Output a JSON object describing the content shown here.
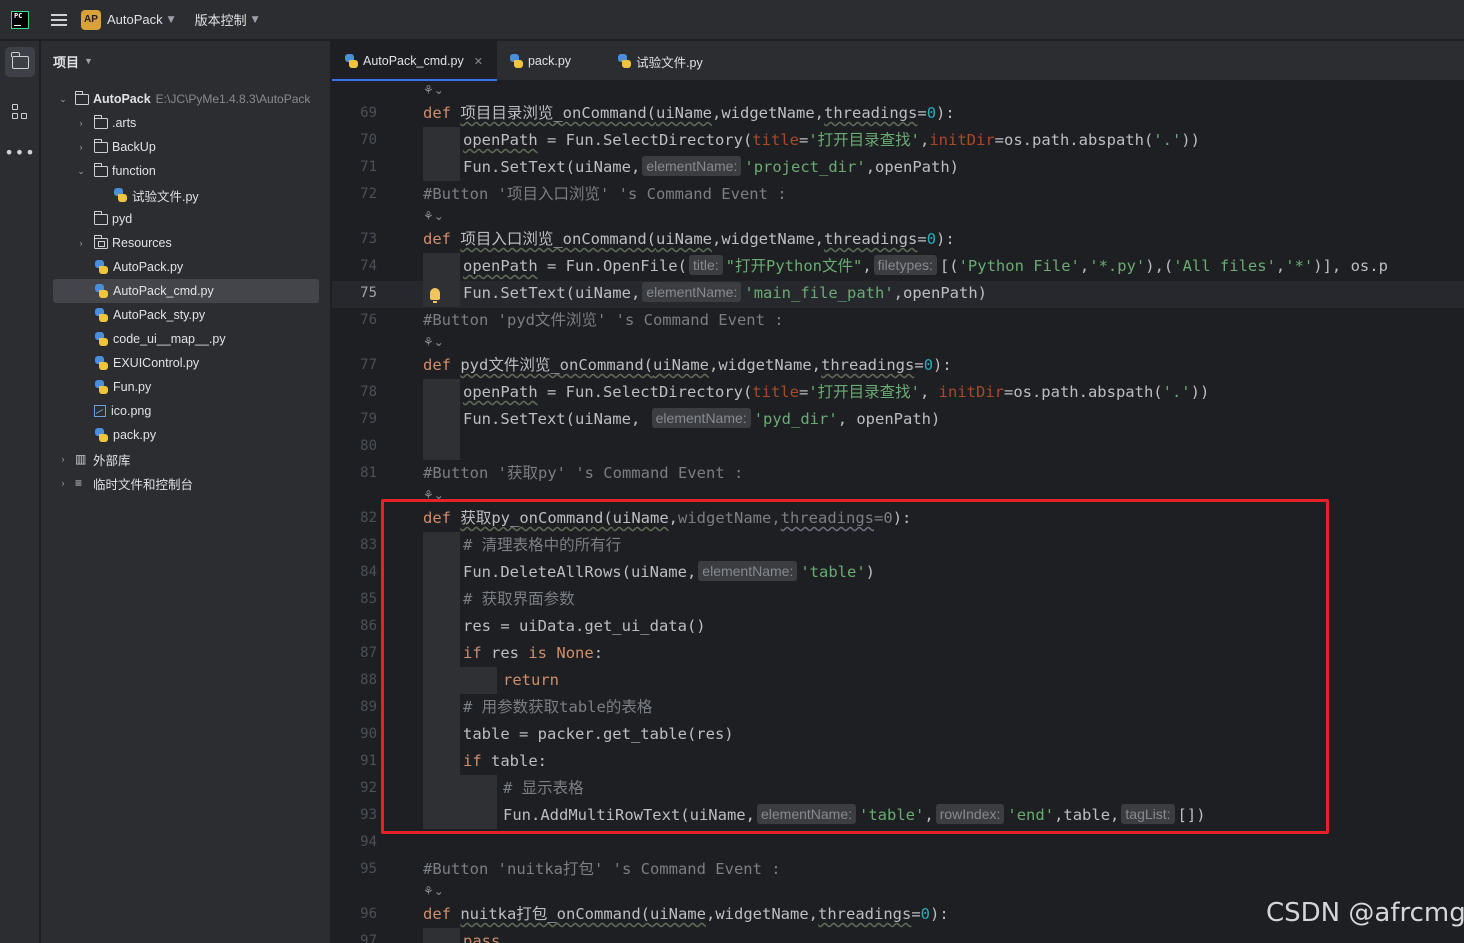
{
  "titlebar": {
    "project_badge": "AP",
    "project_name": "AutoPack",
    "vcs_label": "版本控制"
  },
  "project_panel": {
    "header": "项目",
    "root": {
      "name": "AutoPack",
      "path": "E:\\JC\\PyMe1.4.8.3\\AutoPack"
    },
    "items": [
      {
        "label": ".arts"
      },
      {
        "label": "BackUp"
      },
      {
        "label": "function"
      },
      {
        "label": "试验文件.py"
      },
      {
        "label": "pyd"
      },
      {
        "label": "Resources"
      },
      {
        "label": "AutoPack.py"
      },
      {
        "label": "AutoPack_cmd.py"
      },
      {
        "label": "AutoPack_sty.py"
      },
      {
        "label": "code_ui__map__.py"
      },
      {
        "label": "EXUIControl.py"
      },
      {
        "label": "Fun.py"
      },
      {
        "label": "ico.png"
      },
      {
        "label": "pack.py"
      },
      {
        "label": "外部库"
      },
      {
        "label": "临时文件和控制台"
      }
    ]
  },
  "tabs": [
    {
      "label": "AutoPack_cmd.py",
      "active": true
    },
    {
      "label": "pack.py"
    },
    {
      "label": "试验文件.py"
    }
  ],
  "editor": {
    "current_line": "75",
    "lines": [
      {
        "n": "69"
      },
      {
        "n": "70"
      },
      {
        "n": "71"
      },
      {
        "n": "72"
      },
      {
        "n": "73"
      },
      {
        "n": "74"
      },
      {
        "n": "75"
      },
      {
        "n": "76"
      },
      {
        "n": "77"
      },
      {
        "n": "78"
      },
      {
        "n": "79"
      },
      {
        "n": "80"
      },
      {
        "n": "81"
      },
      {
        "n": "82"
      },
      {
        "n": "83"
      },
      {
        "n": "84"
      },
      {
        "n": "85"
      },
      {
        "n": "86"
      },
      {
        "n": "87"
      },
      {
        "n": "88"
      },
      {
        "n": "89"
      },
      {
        "n": "90"
      },
      {
        "n": "91"
      },
      {
        "n": "92"
      },
      {
        "n": "93"
      },
      {
        "n": "94"
      },
      {
        "n": "95"
      },
      {
        "n": "96"
      },
      {
        "n": "97"
      }
    ],
    "code": {
      "l69": {
        "kw": "def",
        "name": "项目目录浏览_onCommand(",
        "a1": "uiName",
        "a2": "widgetName",
        "a3": "threadings",
        "eq": "=",
        "v": "0",
        "end": "):"
      },
      "l70": {
        "var": "openPath",
        "mid": " = Fun.SelectDirectory(",
        "p1": "title",
        "s1": "'打开目录查找'",
        "p2": "initDir",
        "tail": "=os.path.abspath(",
        "s2": "'.'",
        "end": "))"
      },
      "l71": {
        "pre": "Fun.SetText(uiName,",
        "hint": "elementName:",
        "s1": "'project_dir'",
        "end": ",openPath)"
      },
      "l72": {
        "text": "#Button '项目入口浏览' 's Command Event :"
      },
      "l73": {
        "kw": "def",
        "name": "项目入口浏览_onCommand(",
        "a1": "uiName",
        "a2": "widgetName",
        "a3": "threadings",
        "eq": "=",
        "v": "0",
        "end": "):"
      },
      "l74": {
        "var": "openPath",
        "mid": " = Fun.OpenFile(",
        "h1": "title:",
        "s1": "\"打开Python文件\"",
        "h2": "filetypes:",
        "pre2": "[(",
        "s2": "'Python File'",
        "c1": ",",
        "s3": "'*.py'",
        "mid2": "),(",
        "s4": "'All files'",
        "c2": ",",
        "s5": "'*'",
        "end": ")], os.p"
      },
      "l75": {
        "pre": "Fun.SetText(uiName,",
        "hint": "elementName:",
        "s1": "'main_file_path'",
        "end": ",openPath)"
      },
      "l76": {
        "text": "#Button 'pyd文件浏览' 's Command Event :"
      },
      "l77": {
        "kw": "def",
        "name": "pyd文件浏览_onCommand(",
        "a1": "uiName",
        "a2": "widgetName",
        "a3": "threadings",
        "eq": "=",
        "v": "0",
        "end": "):"
      },
      "l78": {
        "var": "openPath",
        "mid": " = Fun.SelectDirectory(",
        "p1": "title",
        "s1": "'打开目录查找'",
        "comma": ", ",
        "p2": "initDir",
        "tail": "=os.path.abspath(",
        "s2": "'.'",
        "end": "))"
      },
      "l79": {
        "pre": "Fun.SetText(uiName, ",
        "hint": "elementName:",
        "s1": "'pyd_dir'",
        "end": ", openPath)"
      },
      "l81": {
        "text": "#Button '获取py' 's Command Event :"
      },
      "l82": {
        "kw": "def",
        "name": "获取py_onCommand(",
        "a1": "uiName",
        "a2": "widgetName",
        "a3": "threadings",
        "eq": "=",
        "v": "0",
        "end": "):"
      },
      "l83": {
        "text": "# 清理表格中的所有行"
      },
      "l84": {
        "pre": "Fun.DeleteAllRows(uiName,",
        "hint": "elementName:",
        "s1": "'table'",
        "end": ")"
      },
      "l85": {
        "text": "# 获取界面参数"
      },
      "l86": {
        "text": "res = uiData.get_ui_data()"
      },
      "l87": {
        "kw1": "if",
        "mid": " res ",
        "kw2": "is",
        "kw3": "None",
        "end": ":"
      },
      "l88": {
        "kw": "return"
      },
      "l89": {
        "text": "# 用参数获取table的表格"
      },
      "l90": {
        "text": "table = packer.get_table(res)"
      },
      "l91": {
        "kw": "if",
        "end": " table:"
      },
      "l92": {
        "text": "# 显示表格"
      },
      "l93": {
        "pre": "Fun.AddMultiRowText(uiName,",
        "h1": "elementName:",
        "s1": "'table'",
        "c1": ",",
        "h2": "rowIndex:",
        "s2": "'end'",
        "mid": ",table,",
        "h3": "tagList:",
        "end": "[])"
      },
      "l95": {
        "text": "#Button 'nuitka打包' 's Command Event :"
      },
      "l96": {
        "kw": "def",
        "name": "nuitka打包_onCommand(",
        "a1": "uiName",
        "a2": "widgetName",
        "a3": "threadings",
        "eq": "=",
        "v": "0",
        "end": "):"
      },
      "l97": {
        "kw": "pass"
      }
    }
  },
  "watermark": "CSDN @afrcmg",
  "colors": {
    "keyword": "#cf8e6d",
    "string": "#6aab73",
    "number": "#2aacb8",
    "param_name": "#aa4926",
    "comment": "#7a7e85",
    "highlight_box": "#e8202a",
    "tab_accent": "#3574f0"
  },
  "icons": {
    "app_logo": "pycharm-logo-icon",
    "main_menu": "hamburger-menu-icon",
    "project_tool": "folder-icon",
    "structure_tool": "structure-icon",
    "more_tools": "more-horizontal-icon",
    "python_file": "python-file-icon",
    "image_file": "image-file-icon",
    "intention": "lightbulb-icon",
    "decorator_hint": "usage-hint-icon"
  }
}
